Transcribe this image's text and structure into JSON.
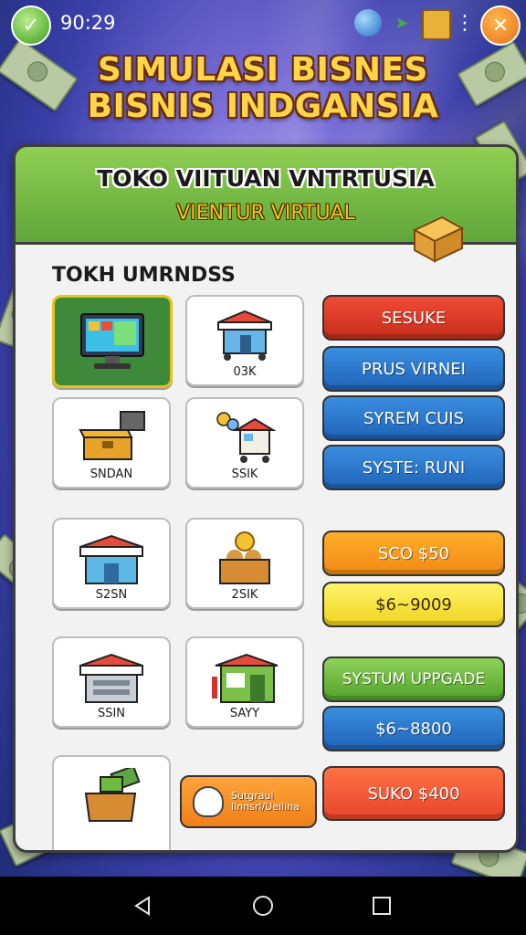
{
  "status_bar": {
    "time": "90:29"
  },
  "title": {
    "line1": "SIMULASI BISNES",
    "line2": "BISNIS INDGANSIA"
  },
  "panel": {
    "title": "TOKO VIITUAN VNTRTUSIA",
    "subtitle": "VIENTUR VIRTUAL",
    "section_title": "TOKH UMRNDSS",
    "tiles": [
      {
        "label": "",
        "icon": "computer-icon"
      },
      {
        "label": "03K",
        "icon": "shop-cart-icon"
      },
      {
        "label": "SNDAN",
        "icon": "chest-icon"
      },
      {
        "label": "SSIK",
        "icon": "balloon-stall-icon"
      },
      {
        "label": "S2SN",
        "icon": "shop-icon"
      },
      {
        "label": "2SIK",
        "icon": "coin-box-icon"
      },
      {
        "label": "SSIN",
        "icon": "store-icon"
      },
      {
        "label": "SAYY",
        "icon": "green-shop-icon"
      },
      {
        "label": "",
        "icon": "money-box-icon"
      }
    ],
    "buttons": [
      {
        "label": "SESUKE",
        "color": "#e1452f"
      },
      {
        "label": "PRUS VIRNEI",
        "color": "#2a77cc"
      },
      {
        "label": "SYREM CUIS",
        "color": "#2a77cc"
      },
      {
        "label": "SYSTE: RUNI",
        "color": "#2a77cc"
      },
      {
        "label": "SCO $50",
        "color": "#f79a1f"
      },
      {
        "label": "$6~9009",
        "color": "#f6e236"
      },
      {
        "label": "SYSTUM UPPGADE",
        "color": "#6fbb3f"
      },
      {
        "label": "$6~8800",
        "color": "#2a86e0"
      },
      {
        "label": "SUKO $400",
        "color": "#f0583a"
      }
    ],
    "badge": {
      "line1": "Sutgraui",
      "line2": "Iinnsrl/Ueilina"
    }
  }
}
